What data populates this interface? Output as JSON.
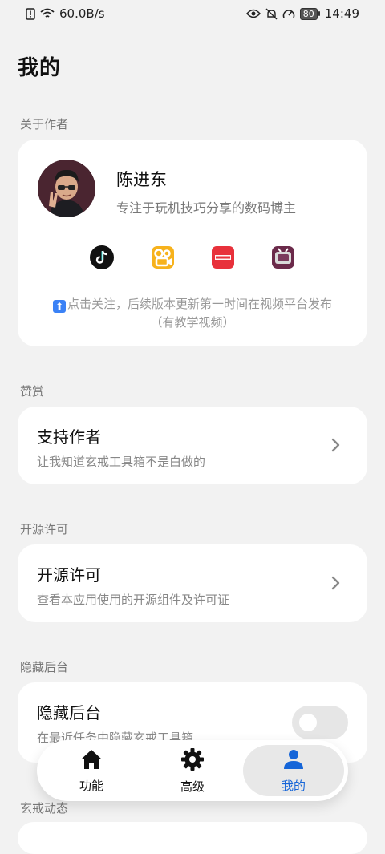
{
  "status_bar": {
    "net_speed": "60.0B/s",
    "battery": "80",
    "time": "14:49"
  },
  "page": {
    "title": "我的"
  },
  "sections": {
    "about": "关于作者",
    "donate": "赞赏",
    "license": "开源许可",
    "hide": "隐藏后台",
    "news": "玄戒动态"
  },
  "author": {
    "name": "陈进东",
    "description": "专注于玩机技巧分享的数码博主",
    "socials": [
      "tiktok-icon",
      "kuaishou-icon",
      "xiaohongshu-icon",
      "bilibili-icon"
    ],
    "follow_text": "点击关注，后续版本更新第一时间在视频平台发布",
    "follow_note": "（有教学视频）"
  },
  "donate_card": {
    "title": "支持作者",
    "subtitle": "让我知道玄戒工具箱不是白做的"
  },
  "license_card": {
    "title": "开源许可",
    "subtitle": "查看本应用使用的开源组件及许可证"
  },
  "hide_card": {
    "title": "隐藏后台",
    "subtitle": "在最近任务中隐藏玄戒工具箱",
    "enabled": false
  },
  "bottom_nav": {
    "items": [
      {
        "label": "功能",
        "icon": "home-icon"
      },
      {
        "label": "高级",
        "icon": "gear-icon"
      },
      {
        "label": "我的",
        "icon": "person-icon"
      }
    ],
    "active_index": 2
  },
  "colors": {
    "background": "#f2f2f2",
    "card": "#ffffff",
    "accent": "#1565d8"
  }
}
